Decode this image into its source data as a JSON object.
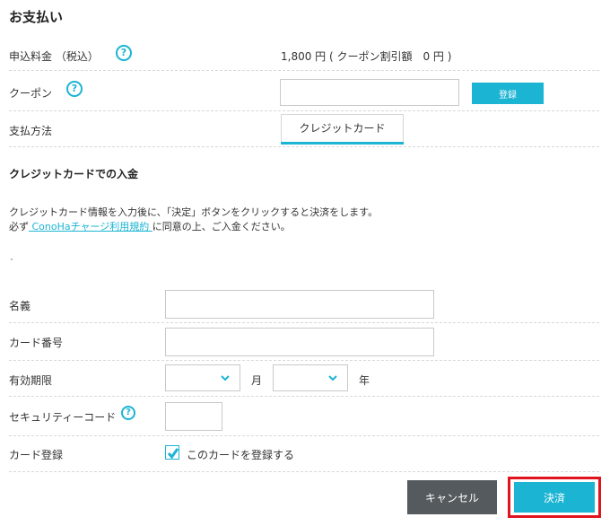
{
  "page": {
    "title": "お支払い"
  },
  "fee": {
    "label": "申込料金 （税込）",
    "value": "1,800 円 ( クーポン割引額　0 円 )"
  },
  "coupon": {
    "label": "クーポン",
    "value": "",
    "placeholder": "",
    "register_label": "登録"
  },
  "payment_method": {
    "label": "支払方法",
    "tab_label": "クレジットカード"
  },
  "credit_section": {
    "heading": "クレジットカードでの入金",
    "desc_line1": "クレジットカード情報を入力後に、「決定」ボタンをクリックすると決済をします。",
    "desc_prefix": "必ず",
    "terms_link": " ConoHaチャージ利用規約 ",
    "desc_suffix": "に同意の上、ご入金ください。"
  },
  "form": {
    "name_label": "名義",
    "name_value": "",
    "card_number_label": "カード番号",
    "card_number_value": "",
    "expiry_label": "有効期限",
    "month_value": "",
    "month_unit": "月",
    "year_value": "",
    "year_unit": "年",
    "security_label": "セキュリティーコード",
    "security_value": "",
    "card_register_label": "カード登録",
    "card_register_checkbox_label": "このカードを登録する",
    "card_register_checked": true
  },
  "actions": {
    "cancel_label": "キャンセル",
    "submit_label": "決済"
  },
  "colors": {
    "accent": "#1bb4d3",
    "cancel_bg": "#555a5e",
    "highlight_border": "#e0141e"
  },
  "icons": {
    "help": "?",
    "chevron": "chevron-down-icon",
    "check": "check-icon"
  }
}
